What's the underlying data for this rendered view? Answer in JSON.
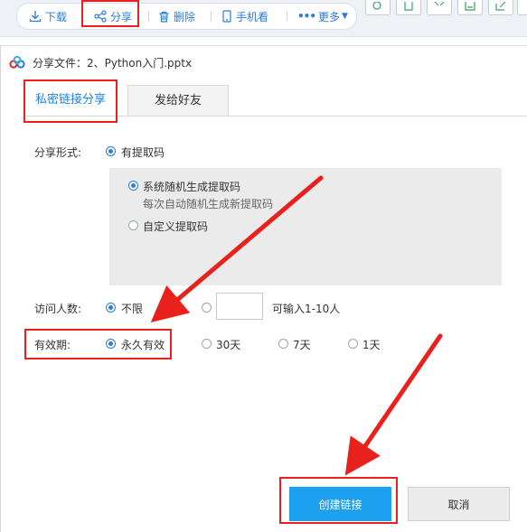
{
  "toolbar": {
    "download_label": "下载",
    "share_label": "分享",
    "delete_label": "删除",
    "mobile_label": "手机看",
    "more_label": "更多"
  },
  "dialog": {
    "title": "分享文件：2、Python入门.pptx",
    "tabs": [
      {
        "label": "私密链接分享",
        "active": true
      },
      {
        "label": "发给好友",
        "active": false
      }
    ],
    "share_form": {
      "label": "分享形式:",
      "option": "有提取码",
      "code_options": [
        {
          "label": "系统随机生成提取码",
          "hint": "每次自动随机生成新提取码",
          "selected": true
        },
        {
          "label": "自定义提取码",
          "selected": false
        }
      ]
    },
    "visitors": {
      "label": "访问人数:",
      "unlimited": "不限",
      "input_value": "",
      "hint": "可输入1-10人",
      "selected": "不限"
    },
    "validity": {
      "label": "有效期:",
      "options": [
        "永久有效",
        "30天",
        "7天",
        "1天"
      ],
      "selected": "永久有效"
    },
    "buttons": {
      "create": "创建链接",
      "cancel": "取消"
    }
  },
  "colors": {
    "accent": "#2d7cd6",
    "primary_button": "#1ea0f1",
    "highlight_box": "#e8211d",
    "arrow": "#e8211d"
  }
}
